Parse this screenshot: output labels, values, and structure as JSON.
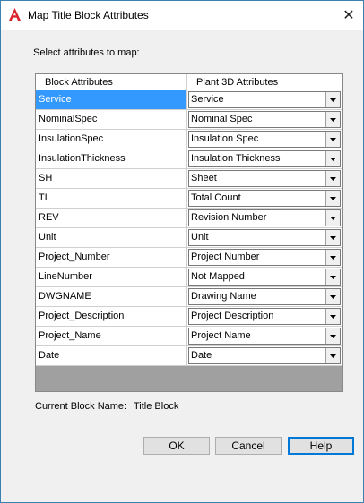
{
  "window": {
    "title": "Map Title Block Attributes",
    "close_symbol": "✕"
  },
  "prompt": "Select attributes to map:",
  "grid": {
    "headers": [
      "Block Attributes",
      "Plant 3D Attributes"
    ],
    "rows": [
      {
        "attribute": "Service",
        "mapped": "Service"
      },
      {
        "attribute": "NominalSpec",
        "mapped": "Nominal Spec"
      },
      {
        "attribute": "InsulationSpec",
        "mapped": "Insulation Spec"
      },
      {
        "attribute": "InsulationThickness",
        "mapped": "Insulation Thickness"
      },
      {
        "attribute": "SH",
        "mapped": "Sheet"
      },
      {
        "attribute": "TL",
        "mapped": "Total Count"
      },
      {
        "attribute": "REV",
        "mapped": "Revision Number"
      },
      {
        "attribute": "Unit",
        "mapped": "Unit"
      },
      {
        "attribute": "Project_Number",
        "mapped": "Project Number"
      },
      {
        "attribute": "LineNumber",
        "mapped": "Not Mapped"
      },
      {
        "attribute": "DWGNAME",
        "mapped": "Drawing Name"
      },
      {
        "attribute": "Project_Description",
        "mapped": "Project Description"
      },
      {
        "attribute": "Project_Name",
        "mapped": "Project Name"
      },
      {
        "attribute": "Date",
        "mapped": "Date"
      }
    ],
    "selected_row": 0
  },
  "current_block": {
    "label": "Current Block Name:",
    "value": "Title Block"
  },
  "buttons": {
    "ok": "OK",
    "cancel": "Cancel",
    "help": "Help"
  },
  "colors": {
    "selection": "#3399ff",
    "app_icon": "#d9232b",
    "default_button_border": "#0078d7"
  },
  "icons": {
    "app": "autocad-a-icon",
    "close": "close-icon",
    "dropdown": "chevron-down-icon"
  }
}
